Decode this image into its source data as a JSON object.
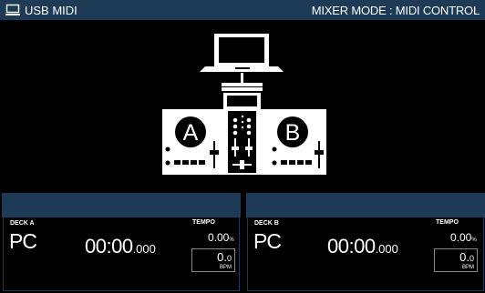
{
  "header": {
    "source_label": "USB MIDI",
    "mode_label": "MIXER MODE : MIDI CONTROL",
    "source_icon": "monitor-icon"
  },
  "diagram": {
    "deck_a_letter": "A",
    "deck_b_letter": "B",
    "icons": [
      "laptop-icon",
      "mixer-icon",
      "turntable-icon"
    ]
  },
  "decks": [
    {
      "label": "DECK A",
      "source": "PC",
      "time_main": "00:00",
      "time_ms": ".000",
      "tempo_label": "TEMPO",
      "tempo_value": "0.00",
      "tempo_unit": "%",
      "bpm_int": "0.",
      "bpm_dec": "0",
      "bpm_unit": "BPM"
    },
    {
      "label": "DECK B",
      "source": "PC",
      "time_main": "00:00",
      "time_ms": ".000",
      "tempo_label": "TEMPO",
      "tempo_value": "0.00",
      "tempo_unit": "%",
      "bpm_int": "0.",
      "bpm_dec": "0",
      "bpm_unit": "BPM"
    }
  ],
  "colors": {
    "header_bg": "#1d3b57",
    "background": "#000000",
    "foreground": "#ffffff"
  }
}
